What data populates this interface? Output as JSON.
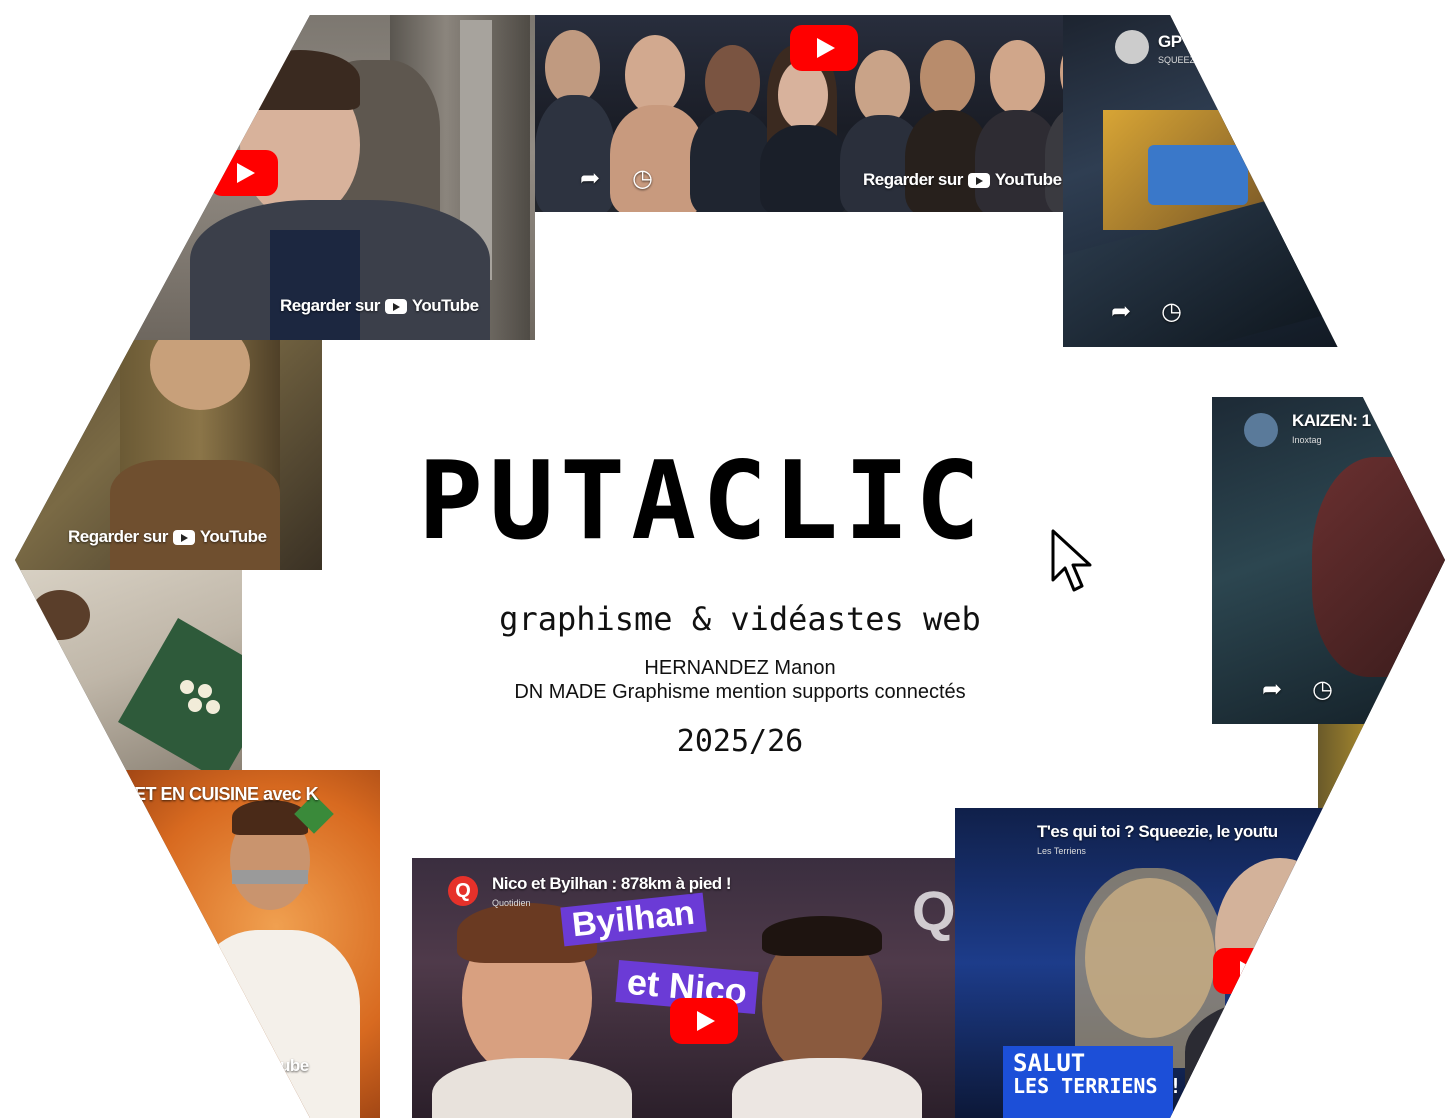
{
  "main": {
    "title": "PUTACLIC",
    "subtitle": "graphisme & vidéastes web",
    "author_name": "HERNANDEZ Manon",
    "author_program": "DN MADE Graphisme mention supports connectés",
    "year": "2025/26"
  },
  "thumbnails": {
    "watch_label": "Regarder sur",
    "youtube_label": "YouTube",
    "youtube_label_alt": "YouTube",
    "gp": {
      "title": "GP I",
      "channel": "SQUEEZIE"
    },
    "kaizen": {
      "title": "KAIZEN: 1",
      "channel": "Inoxtag"
    },
    "cuisine": {
      "title": "ET EN CUISINE avec K",
      "watch_fragment": "ube"
    },
    "nico": {
      "title": "Nico et Byilhan : 878km à pied !",
      "channel": "Quotidien",
      "tag1": "Byilhan",
      "tag2": "et Nico",
      "logo": "Q",
      "watermark": "Q."
    },
    "squeezie": {
      "title": "T'es qui toi ? Squeezie, le youtu",
      "channel": "Les Terriens",
      "salut": "SALUT",
      "les": "LES",
      "terriens": "TERRIENS !"
    }
  },
  "colors": {
    "youtube_red": "#ff0000",
    "quotidien_red": "#e6312a",
    "tag_purple": "#6b3bd6",
    "salut_blue": "#1c4fd8"
  },
  "icons": [
    "play-icon",
    "share-icon",
    "watch-later-icon",
    "cursor-icon",
    "youtube-logo-icon"
  ]
}
